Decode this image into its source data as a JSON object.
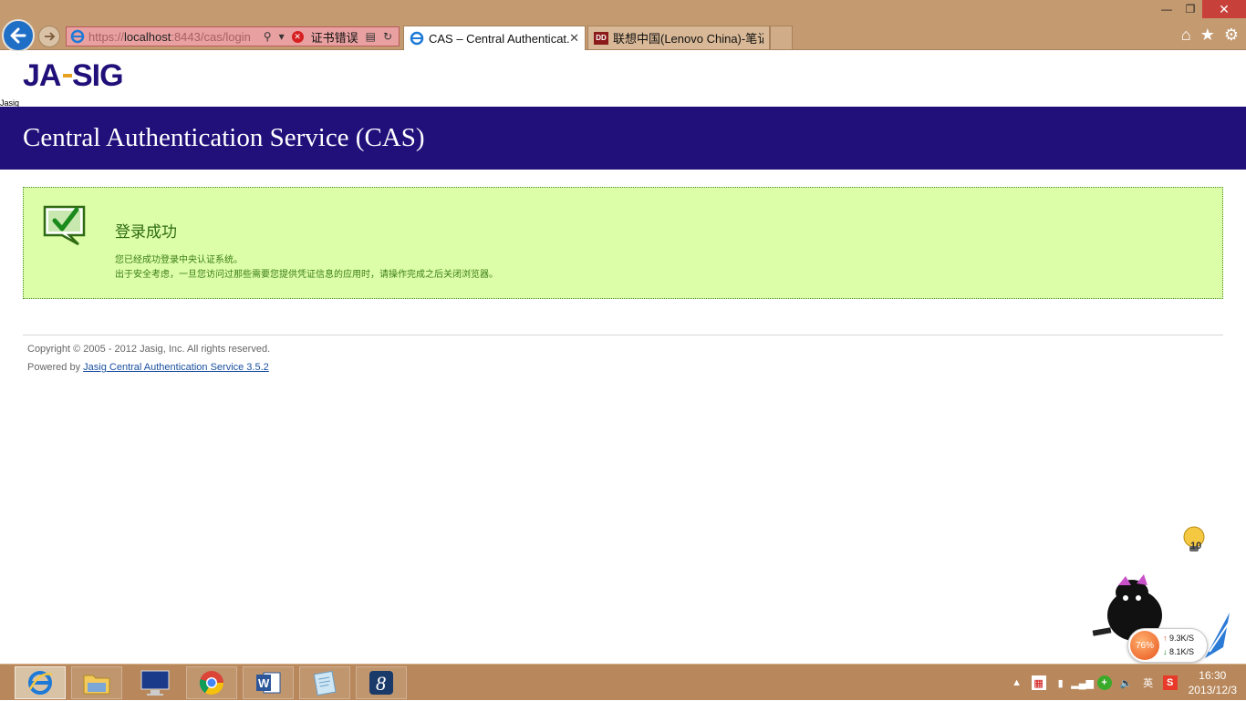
{
  "browser": {
    "url_proto": "https://",
    "url_host": "localhost",
    "url_rest": ":8443/cas/login",
    "cert_error_label": "证书错误",
    "tabs": [
      {
        "label": "CAS – Central Authenticat...",
        "active": true
      },
      {
        "label": "联想中国(Lenovo China)-笔记...",
        "active": false
      }
    ]
  },
  "page": {
    "logo_text": "JA-SIG",
    "logo_alt": "Jasig",
    "banner_title": "Central Authentication Service (CAS)",
    "message": {
      "title": "登录成功",
      "line1": "您已经成功登录中央认证系统。",
      "line2": "出于安全考虑，一旦您访问过那些需要您提供凭证信息的应用时，请操作完成之后关闭浏览器。"
    },
    "footer": {
      "copyright": "Copyright © 2005 - 2012 Jasig, Inc. All rights reserved.",
      "powered_prefix": "Powered by",
      "powered_link": "Jasig Central Authentication Service 3.5.2"
    },
    "notification_count": "10"
  },
  "net_meter": {
    "percent": "76%",
    "up": "9.3K/S",
    "down": "8.1K/S"
  },
  "taskbar": {
    "apps": [
      "internet-explorer",
      "file-explorer",
      "lenovo",
      "chrome",
      "word",
      "notepad",
      "app-8"
    ],
    "ime": "英",
    "time": "16:30",
    "date": "2013/12/3"
  },
  "colors": {
    "banner": "#210f7a",
    "message_bg": "#ddfea8",
    "message_text": "#2e6b12",
    "link": "#1a4fa0"
  }
}
